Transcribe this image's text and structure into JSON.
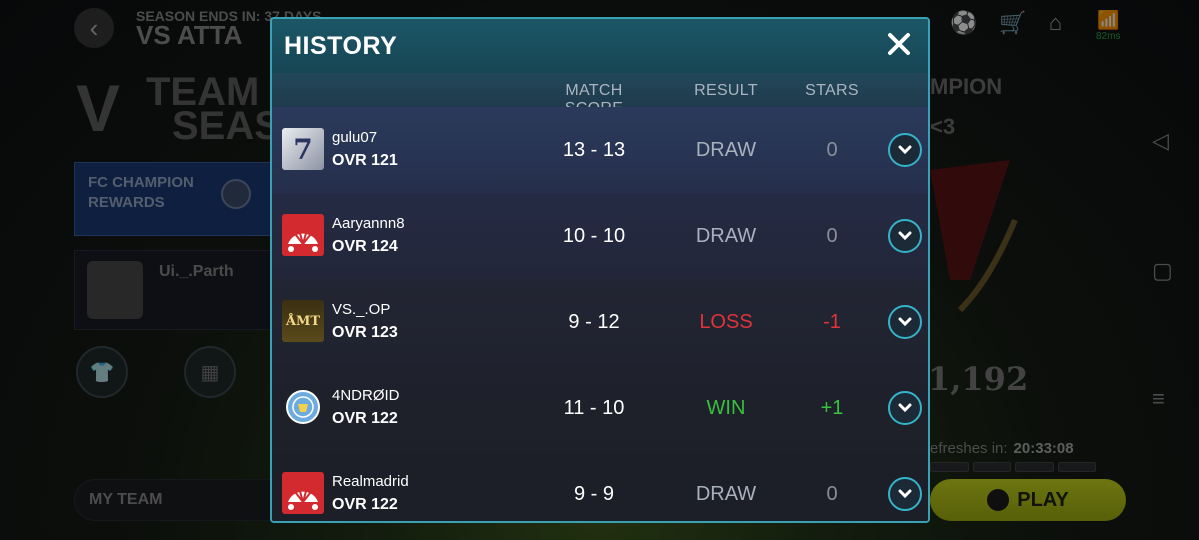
{
  "background": {
    "season_ends": "SEASON ENDS IN: 37 DAYS",
    "mode_title": "VS ATTA",
    "tots": {
      "v": "V",
      "line1": "TEAM",
      "line2": "SEAS"
    },
    "rewards_label": "FC CHAMPION REWARDS",
    "profile_name": "Ui._.Parth",
    "right_title": "MPION",
    "right_sub": "<3",
    "points": "1,192",
    "refresh_label": "efreshes in:",
    "refresh_time": "20:33:08",
    "my_team_label": "MY TEAM",
    "play_label": "PLAY",
    "ping": "82ms"
  },
  "modal": {
    "title": "HISTORY",
    "columns": {
      "match_score": "MATCH SCORE",
      "result": "RESULT",
      "stars": "STARS"
    },
    "rows": [
      {
        "name": "gulu07",
        "ovr": "OVR 121",
        "score": "13 - 13",
        "result": "DRAW",
        "stars": "0",
        "crest": "seven"
      },
      {
        "name": "Aaryannn8",
        "ovr": "OVR 124",
        "score": "10 - 10",
        "result": "DRAW",
        "stars": "0",
        "crest": "fan"
      },
      {
        "name": "VS._.OP",
        "ovr": "OVR 123",
        "score": "9 - 12",
        "result": "LOSS",
        "stars": "-1",
        "crest": "amt"
      },
      {
        "name": "4NDRØID",
        "ovr": "OVR 122",
        "score": "11 - 10",
        "result": "WIN",
        "stars": "+1",
        "crest": "city"
      },
      {
        "name": "Realmadrid",
        "ovr": "OVR 122",
        "score": "9 - 9",
        "result": "DRAW",
        "stars": "0",
        "crest": "fan"
      }
    ],
    "crest_seven_text": "7",
    "crest_amt_text": "ÅMT"
  },
  "colors": {
    "draw": "#a9b1bd",
    "loss": "#e0333a",
    "win": "#36c23b",
    "stars_neutral": "#8a8f99",
    "accent": "#35b3c8"
  }
}
